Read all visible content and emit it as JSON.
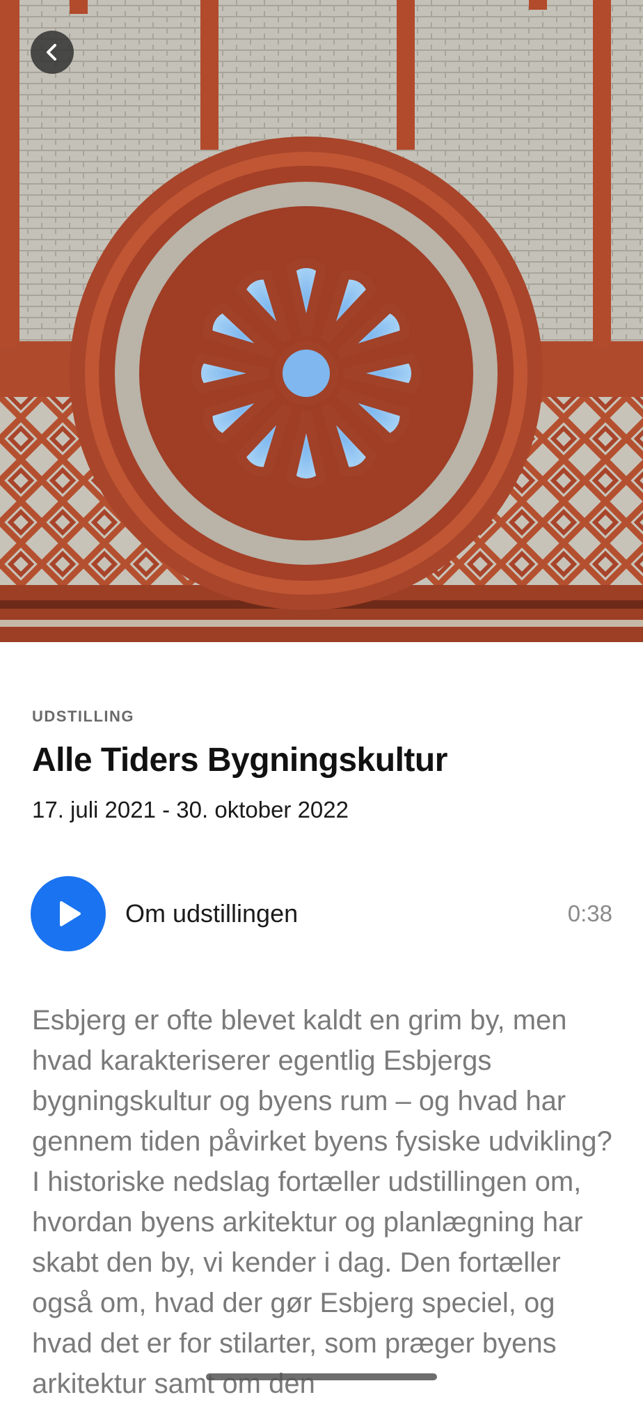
{
  "hero": {
    "image_alt": "Red brick rose window facade",
    "back_icon": "chevron-left-icon"
  },
  "exhibition": {
    "category": "UDSTILLING",
    "title": "Alle Tiders Bygningskultur",
    "dates": "17. juli 2021 - 30. oktober 2022"
  },
  "audio": {
    "play_icon": "play-icon",
    "label": "Om udstillingen",
    "duration": "0:38",
    "accent": "#1a73f0"
  },
  "description": "Esbjerg er ofte blevet kaldt en grim by, men hvad karakteriserer egentlig Esbjergs bygningskultur og byens rum – og hvad har gennem tiden påvirket byens fysiske udvikling? I historiske nedslag fortæller udstillingen om, hvordan byens arkitektur og planlægning har skabt den by, vi kender i dag. Den fortæller også om, hvad der gør Esbjerg speciel, og hvad det er for stilarter, som præger byens arkitektur samt om den"
}
